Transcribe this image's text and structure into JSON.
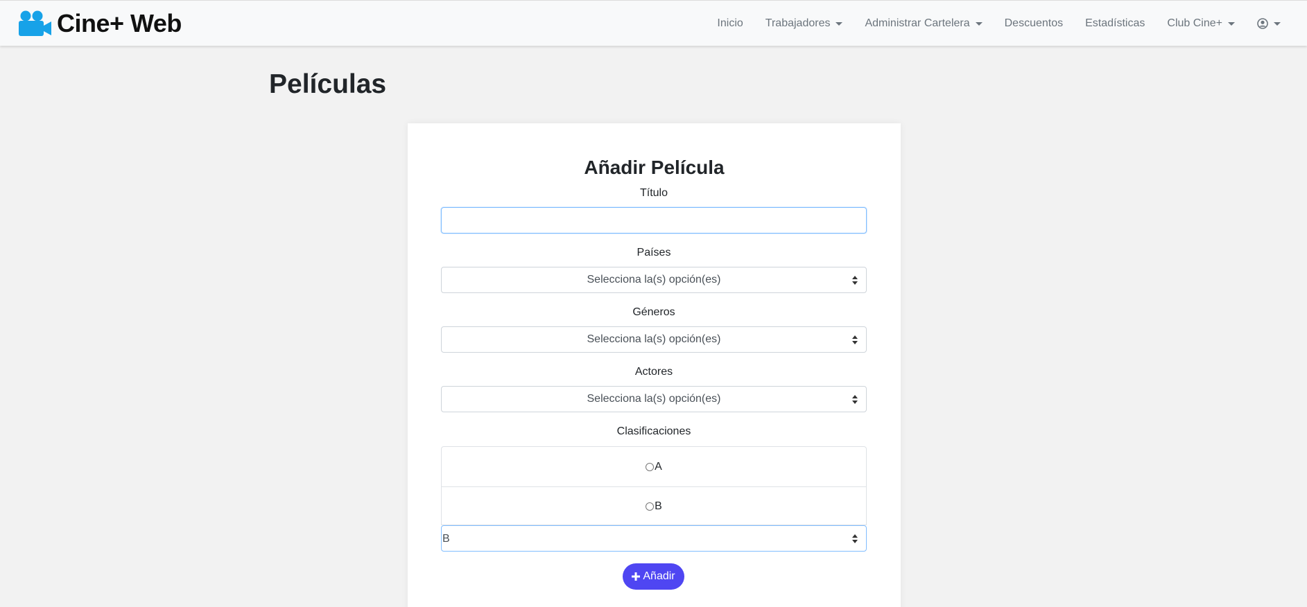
{
  "navbar": {
    "brand": "Cine+ Web",
    "items": [
      {
        "label": "Inicio",
        "dropdown": false
      },
      {
        "label": "Trabajadores",
        "dropdown": true
      },
      {
        "label": "Administrar Cartelera",
        "dropdown": true
      },
      {
        "label": "Descuentos",
        "dropdown": false
      },
      {
        "label": "Estadísticas",
        "dropdown": false
      },
      {
        "label": "Club Cine+",
        "dropdown": true
      }
    ],
    "user_icon": "user-circle-icon"
  },
  "page": {
    "title": "Películas"
  },
  "form": {
    "title": "Añadir Película",
    "titulo_label": "Título",
    "titulo_value": "",
    "paises_label": "Países",
    "paises_placeholder": "Selecciona la(s) opción(es)",
    "generos_label": "Géneros",
    "generos_placeholder": "Selecciona la(s) opción(es)",
    "actores_label": "Actores",
    "actores_placeholder": "Selecciona la(s) opción(es)",
    "clasificaciones_label": "Clasificaciones",
    "clasificaciones_options": [
      "A",
      "B"
    ],
    "clasificacion_selected": "B",
    "submit_label": "Añadir"
  },
  "colors": {
    "accent": "#4f46f2",
    "brand_icon": "#17a2e8",
    "background": "#f2f2f2"
  }
}
